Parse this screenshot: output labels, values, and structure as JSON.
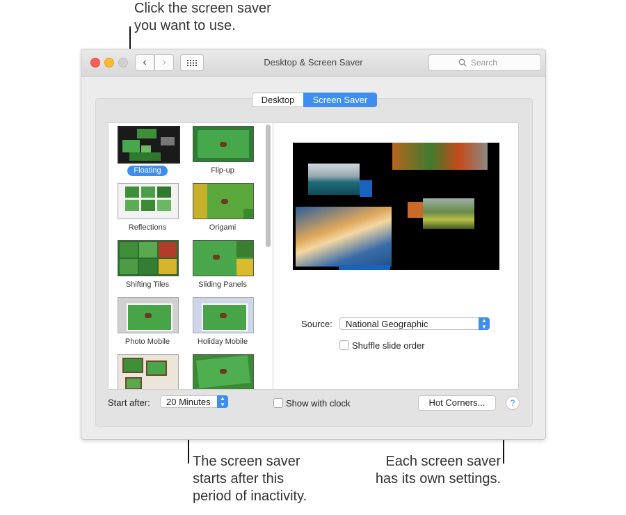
{
  "callouts": {
    "top": "Click the screen saver\nyou want to use.",
    "bottom_left": "The screen saver\nstarts after this\nperiod of inactivity.",
    "bottom_right": "Each screen saver\nhas its own settings."
  },
  "window": {
    "title": "Desktop & Screen Saver",
    "search_placeholder": "Search",
    "tabs": [
      {
        "label": "Desktop",
        "selected": false
      },
      {
        "label": "Screen Saver",
        "selected": true
      }
    ]
  },
  "savers": [
    {
      "label": "Floating",
      "selected": true
    },
    {
      "label": "Flip-up"
    },
    {
      "label": "Reflections"
    },
    {
      "label": "Origami"
    },
    {
      "label": "Shifting Tiles"
    },
    {
      "label": "Sliding Panels"
    },
    {
      "label": "Photo Mobile"
    },
    {
      "label": "Holiday Mobile"
    },
    {
      "label": ""
    },
    {
      "label": ""
    }
  ],
  "settings": {
    "source_label": "Source:",
    "source_value": "National Geographic",
    "shuffle_label": "Shuffle slide order",
    "shuffle_checked": false
  },
  "footer": {
    "start_after_label": "Start after:",
    "start_after_value": "20 Minutes",
    "show_clock_label": "Show with clock",
    "show_clock_checked": false,
    "hot_corners_label": "Hot Corners...",
    "help_label": "?"
  },
  "colors": {
    "accent": "#3d8ef0",
    "close": "#fc5f57",
    "minimize": "#fdbc2e",
    "zoom_inactive": "#d0d0d0"
  }
}
